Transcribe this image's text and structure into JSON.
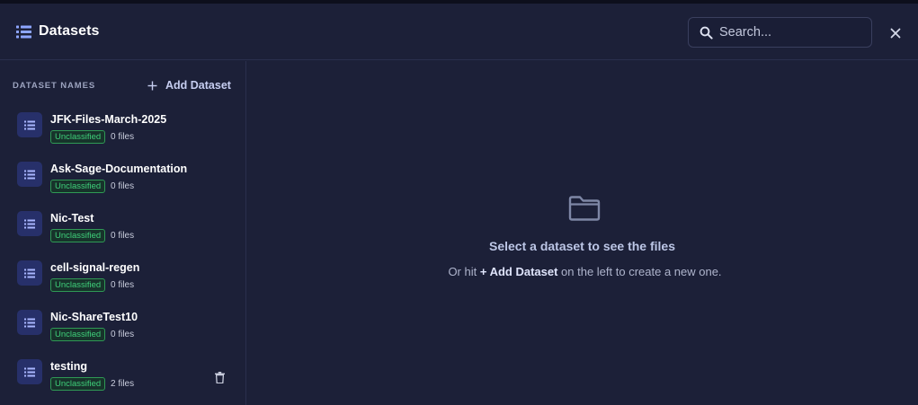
{
  "header": {
    "title": "Datasets",
    "icon": "list-icon"
  },
  "search": {
    "placeholder": "Search...",
    "value": ""
  },
  "sidebar": {
    "heading": "DATASET NAMES",
    "add_label": "Add Dataset",
    "items": [
      {
        "name": "JFK-Files-March-2025",
        "classification": "Unclassified",
        "files": "0 files"
      },
      {
        "name": "Ask-Sage-Documentation",
        "classification": "Unclassified",
        "files": "0 files"
      },
      {
        "name": "Nic-Test",
        "classification": "Unclassified",
        "files": "0 files"
      },
      {
        "name": "cell-signal-regen",
        "classification": "Unclassified",
        "files": "0 files"
      },
      {
        "name": "Nic-ShareTest10",
        "classification": "Unclassified",
        "files": "0 files"
      },
      {
        "name": "testing",
        "classification": "Unclassified",
        "files": "2 files"
      }
    ]
  },
  "empty_state": {
    "title": "Select a dataset to see the files",
    "sub_prefix": "Or hit ",
    "sub_action": "+ Add Dataset",
    "sub_suffix": " on the left to create a new one."
  },
  "colors": {
    "background": "#1c2038",
    "badge_green": "#3fd07a",
    "accent": "#6f8bf5"
  }
}
